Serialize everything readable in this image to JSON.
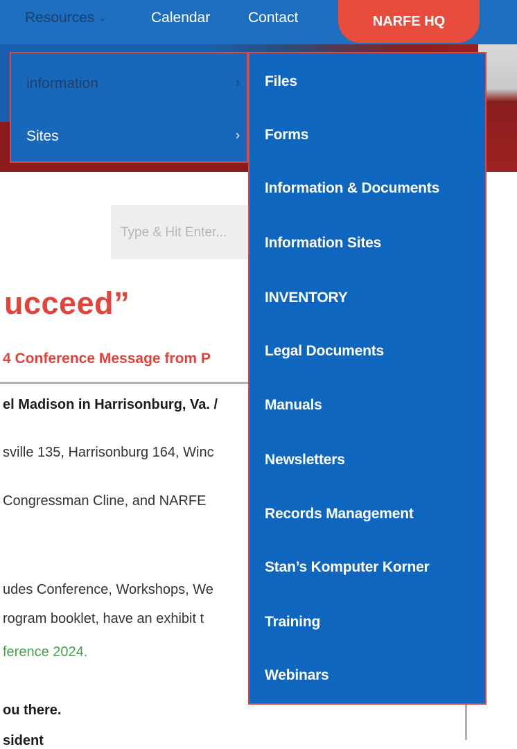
{
  "nav": {
    "resources_label": "Resources",
    "resources_chevron": "⌄",
    "calendar_label": "Calendar",
    "contact_label": "Contact",
    "hq_label": "NARFE HQ"
  },
  "menu1": {
    "items": [
      {
        "label": "information",
        "chevron": "›"
      },
      {
        "label": "Sites",
        "chevron": "›"
      }
    ]
  },
  "menu2": {
    "items": [
      {
        "label": "Files"
      },
      {
        "label": "Forms"
      },
      {
        "label": "Information & Documents"
      },
      {
        "label": "Information Sites"
      },
      {
        "label": "INVENTORY"
      },
      {
        "label": "Legal Documents"
      },
      {
        "label": "Manuals"
      },
      {
        "label": "Newsletters"
      },
      {
        "label": "Records Management"
      },
      {
        "label": "Stan’s Komputer Korner"
      },
      {
        "label": "Training"
      },
      {
        "label": "Webinars"
      }
    ]
  },
  "search": {
    "placeholder": "Type & Hit Enter..."
  },
  "article": {
    "headline": "ucceed”",
    "subhead": "4 Conference Message from P",
    "location_line": "el Madison in Harrisonburg, Va. /",
    "lines": [
      "sville 135, Harrisonburg 164, Winc",
      " Congressman Cline, and NARFE",
      "udes Conference, Workshops, We",
      "rogram booklet, have an exhibit t"
    ],
    "link_text": "ference 2024.",
    "closing": "ou there.",
    "signoff": "sident"
  }
}
